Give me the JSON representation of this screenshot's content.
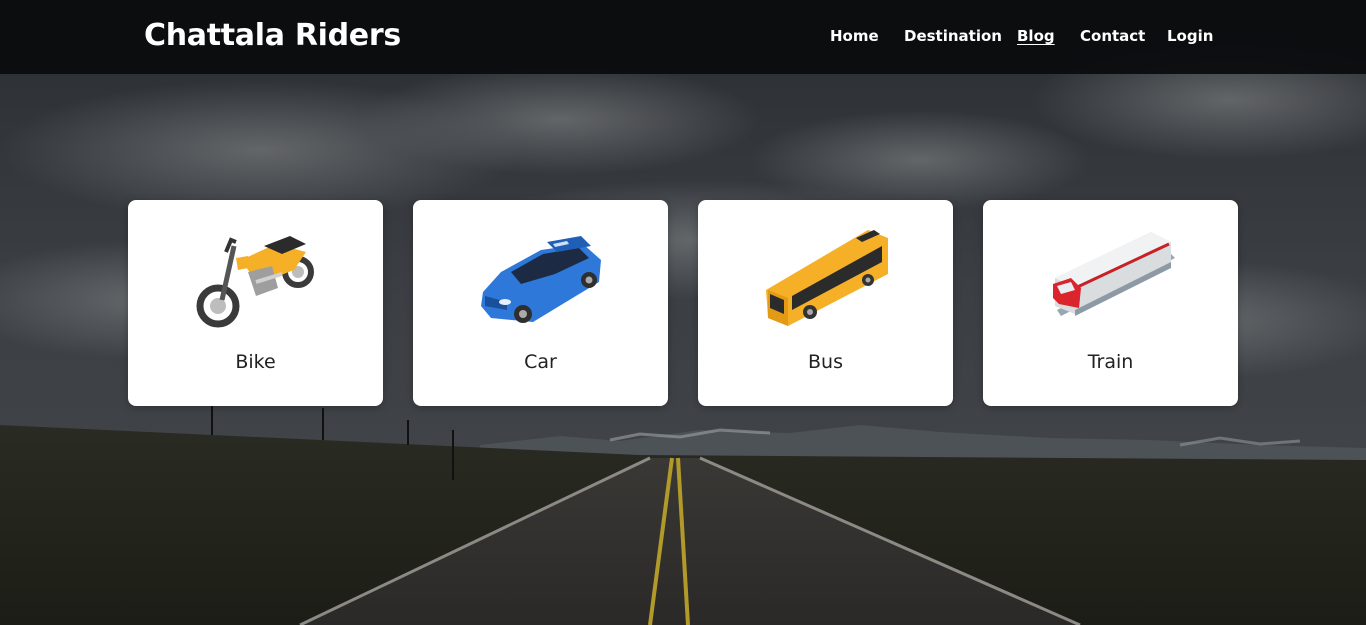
{
  "brand": {
    "title": "Chattala Riders"
  },
  "nav": {
    "items": [
      {
        "label": "Home",
        "active": false
      },
      {
        "label": "Destination",
        "active": false
      },
      {
        "label": "Blog",
        "active": true
      },
      {
        "label": "Contact",
        "active": false
      },
      {
        "label": "Login",
        "active": false
      }
    ]
  },
  "vehicles": [
    {
      "label": "Bike",
      "icon": "motorcycle-icon",
      "color": "#f5b027"
    },
    {
      "label": "Car",
      "icon": "car-icon",
      "color": "#2d78d9"
    },
    {
      "label": "Bus",
      "icon": "bus-icon",
      "color": "#f5b027"
    },
    {
      "label": "Train",
      "icon": "train-icon",
      "color": "#d9252b"
    }
  ],
  "colors": {
    "navbar": "#0a0b0d",
    "card": "#ffffff",
    "text_light": "#ffffff",
    "text_dark": "#222222"
  }
}
